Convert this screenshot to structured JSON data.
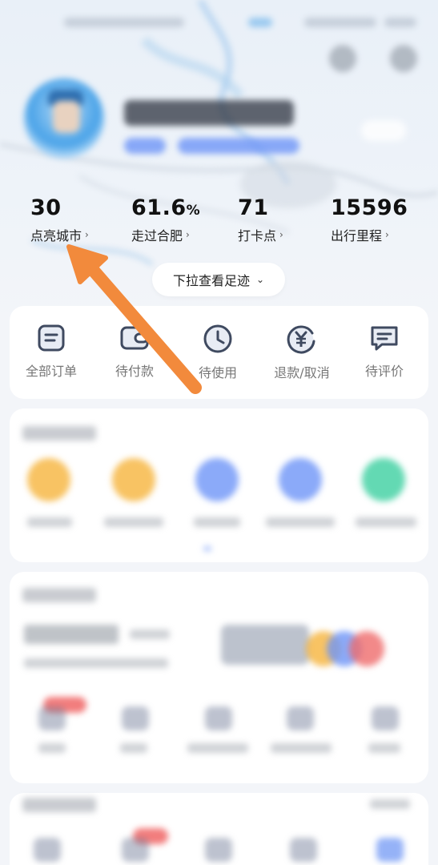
{
  "stats": [
    {
      "value": "30",
      "unit": "",
      "label": "点亮城市"
    },
    {
      "value": "61.6",
      "unit": "%",
      "label": "走过合肥"
    },
    {
      "value": "71",
      "unit": "",
      "label": "打卡点"
    },
    {
      "value": "15596",
      "unit": "",
      "label": "出行里程"
    }
  ],
  "pull_button": {
    "label": "下拉查看足迹"
  },
  "orders": [
    {
      "label": "全部订单",
      "icon": "order-list-icon"
    },
    {
      "label": "待付款",
      "icon": "wallet-icon"
    },
    {
      "label": "待使用",
      "icon": "clock-icon"
    },
    {
      "label": "退款/取消",
      "icon": "yuan-refund-icon"
    },
    {
      "label": "待评价",
      "icon": "comment-icon"
    }
  ],
  "colors": {
    "accent_orange": "#f28a3c",
    "icon_dark": "#3f4a60",
    "blue_tag": "#6e95f7",
    "ball_yellow": "#f6b43c",
    "ball_blue": "#6e95f7",
    "ball_green": "#3ccfa0"
  }
}
